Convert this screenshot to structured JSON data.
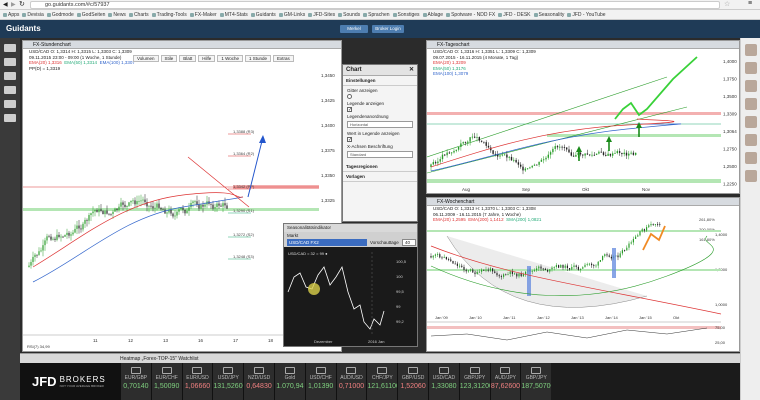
{
  "browser": {
    "url": "go.guidants.com/#c/57937"
  },
  "bookmarks": [
    "Apps",
    "Devisia",
    "Godmode",
    "GodSeiten",
    "News",
    "Charts",
    "Trading-Tools",
    "FX-Maker",
    "MT4-Stats",
    "Guidants",
    "GM-Links",
    "JFD-Sites",
    "Sounds",
    "Sprachen",
    "Sonstiges",
    "Ablage",
    "Spotware - NDD FX",
    "JFD - DESK",
    "Seasonality",
    "JFD - YouTube"
  ],
  "app": {
    "logo": "Guidants",
    "btn1": "Merkel",
    "btn2": "Broker Login"
  },
  "panel_left": {
    "title": "FX-Stundenchart",
    "info1": "USD/CAD  O: 1,3314  H: 1,3315  L: 1,3303  C: 1,3309",
    "info2": "09.11.2015 23:00 - 09:00 (1 Woche, 1 Stunde)",
    "ema20": "EMA(20) 1,3316",
    "ema50": "EMA(50) 1,3314",
    "ema100": "EMA(100) 1,3307",
    "pp": "PP(D) = 1,3319",
    "prices": [
      "1,3450",
      "1,3425",
      "1,3400",
      "1,3375",
      "1,3350",
      "1,3325",
      "1,3300",
      "1,3275"
    ],
    "levels": [
      "1,3388 (R3)",
      "1,3364 (R2)",
      "1,3342 (PP)",
      "1,3290 (S1)",
      "1,3272 (S2)",
      "1,3248 (S3)"
    ],
    "xdates": [
      "11",
      "12",
      "13",
      "16",
      "17",
      "18"
    ],
    "footer": "RSI(7) 34,99"
  },
  "tooltabs": [
    "Volumen",
    "Stile",
    "Blatt",
    "Hilfe",
    "1 Woche",
    "1 Stunde",
    "Extras"
  ],
  "settings": {
    "title": "Chart",
    "sec1": "Einstellungen",
    "gitter": "Gitter anzeigen",
    "legende": "Legende anzeigen",
    "anordnung": "Legendenanordnung",
    "anordnung_val": "Horizontal",
    "wert": "Wert in Legende anzeigen",
    "xachse": "X-Achsen Beschriftung",
    "xachse_val": "Standard",
    "sec2": "Tagesregionen",
    "sec3": "Vorlagen"
  },
  "seasonal": {
    "title": "Seasonalitätsindikator",
    "tab": "Markt",
    "symbol": "USD/CAD FX2",
    "label": "Vorschauttage",
    "days": "40",
    "legend": "USD/CAD = 32 = 99 ●",
    "yvals": [
      "100,5",
      "100",
      "99,5",
      "99",
      "99,2"
    ],
    "x1": "Dezember",
    "x2": "2016 Jan"
  },
  "panel_top_right": {
    "title": "FX-Tageschart",
    "info1": "USD/CAD  O: 1,3316  H: 1,3351  L: 1,3309  C: 1,3309",
    "info2": "09.07.2015 - 16.11.2015 (4 Monate, 1 Tag)",
    "ema20": "EMA(20) 1,3209",
    "ema50": "EMA(50) 1,3176",
    "ema100": "EMA(100) 1,3079",
    "prices": [
      "1,4000",
      "1,3750",
      "1,3500",
      "1,3309",
      "1,3064",
      "1,2750",
      "1,2500",
      "1,2250"
    ],
    "xdates": [
      "Aug",
      "Sep",
      "Okt",
      "Nov"
    ]
  },
  "panel_bottom_right": {
    "title": "FX-Wochenchart",
    "info1": "USD/CAD  O: 1,3313  H: 1,3370  L: 1,3303  C: 1,3308",
    "info2": "06.11.2009 - 16.11.2015 (7 Jahre, 1 Woche)",
    "ema20": "EMA(20) 1,2595",
    "ema200": "EMA(200) 1,1412",
    "sma": "SMA(200) 1,0821",
    "pcts": [
      "261,80%",
      "200,00%",
      "161,80%"
    ],
    "prices": [
      "1,4000",
      "1,2000",
      "1,0000"
    ],
    "xdates": [
      "Jan '09",
      "Jan '10",
      "Jan '11",
      "Jan '12",
      "Jan '13",
      "Jan '14",
      "Jan '15",
      "Okt"
    ],
    "rsi": [
      "75,00",
      "25,00"
    ]
  },
  "bottombar": {
    "label": "Heatmap „Forex-TOP-15\" Watchlist"
  },
  "quotes_logo": {
    "brand": "JFD",
    "brand2": "BROKERS",
    "tagline": "NOT YOUR AVERAGE BROKER"
  },
  "quotes": [
    {
      "sym": "EUR/GBP",
      "val": "0,70140",
      "dir": "up"
    },
    {
      "sym": "EUR/CHF",
      "val": "1,50090",
      "dir": "up"
    },
    {
      "sym": "EUR/USD",
      "val": "1,06660",
      "dir": "down"
    },
    {
      "sym": "USD/JPY",
      "val": "131,52600",
      "dir": "up"
    },
    {
      "sym": "NZD/USD",
      "val": "0,64830",
      "dir": "down"
    },
    {
      "sym": "Gold",
      "val": "1.070,94",
      "dir": "up"
    },
    {
      "sym": "USD/CHF",
      "val": "1,01390",
      "dir": "up"
    },
    {
      "sym": "AUD/USD",
      "val": "0,71000",
      "dir": "down"
    },
    {
      "sym": "CHF/JPY",
      "val": "121,61100",
      "dir": "up"
    },
    {
      "sym": "GBP/USD",
      "val": "1,52060",
      "dir": "down"
    },
    {
      "sym": "USD/CAD",
      "val": "1,33080",
      "dir": "up"
    },
    {
      "sym": "GBP/JPY",
      "val": "123,31200",
      "dir": "up"
    },
    {
      "sym": "AUD/JPY",
      "val": "87,62600",
      "dir": "down"
    },
    {
      "sym": "GBP/JPY",
      "val": "187,50700",
      "dir": "up"
    }
  ],
  "colors": {
    "header": "#1f3b57",
    "bull": "#2a9d2a",
    "bear": "#d33333"
  }
}
